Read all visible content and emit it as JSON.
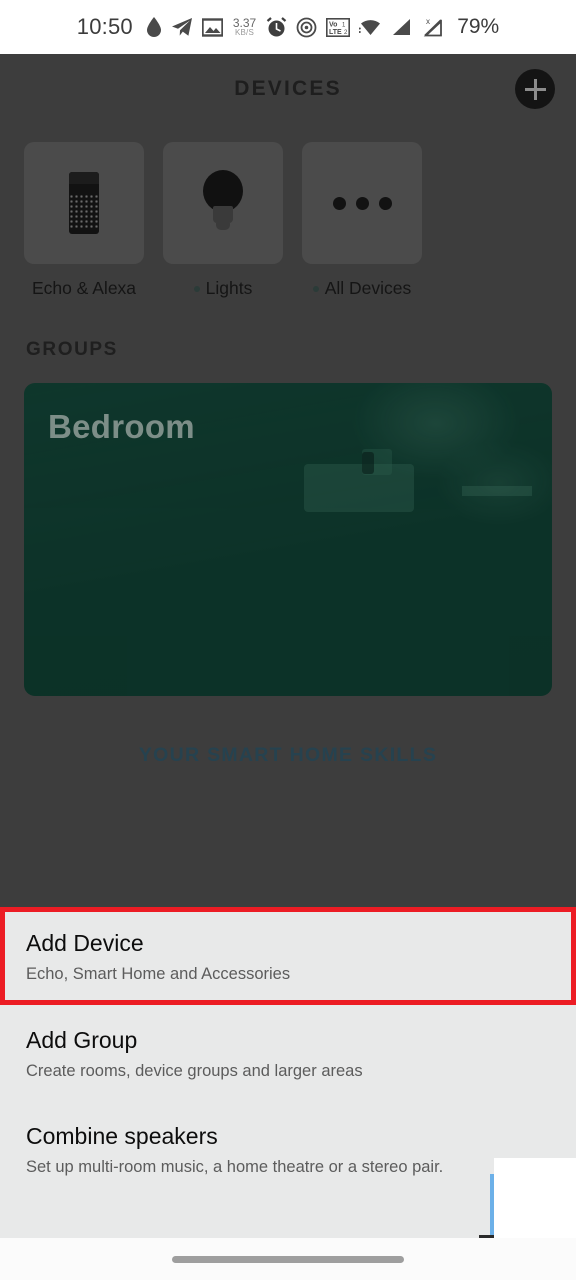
{
  "status_bar": {
    "time": "10:50",
    "network_speed_value": "3.37",
    "network_speed_unit": "KB/S",
    "battery": "79%",
    "icons": [
      "water-drop-icon",
      "telegram-icon",
      "photo-icon",
      "alarm-icon",
      "cast-icon",
      "volte-icon",
      "wifi-icon",
      "signal-icon",
      "signal-no-sim-icon"
    ]
  },
  "app": {
    "header": {
      "title": "DEVICES",
      "add_button_icon": "plus-icon"
    },
    "categories": [
      {
        "label": "Echo & Alexa",
        "icon": "echo-speaker-icon",
        "has_dot": false
      },
      {
        "label": "Lights",
        "icon": "light-bulb-icon",
        "has_dot": true
      },
      {
        "label": "All Devices",
        "icon": "ellipsis-icon",
        "has_dot": true
      }
    ],
    "groups": {
      "heading": "GROUPS",
      "cards": [
        {
          "name": "Bedroom",
          "color": "#0d3329"
        }
      ]
    },
    "skills_link": "YOUR SMART HOME SKILLS",
    "close_icon": "close-x-icon"
  },
  "bottom_sheet": {
    "items": [
      {
        "title": "Add Device",
        "subtitle": "Echo, Smart Home and Accessories",
        "highlighted": true,
        "highlight_color": "#ec1c24"
      },
      {
        "title": "Add Group",
        "subtitle": "Create rooms, device groups and larger areas",
        "highlighted": false
      },
      {
        "title": "Combine speakers",
        "subtitle": "Set up multi-room music, a home theatre or a stereo pair.",
        "highlighted": false
      }
    ]
  },
  "nav_bar": {
    "pill_icon": "home-pill-indicator"
  }
}
